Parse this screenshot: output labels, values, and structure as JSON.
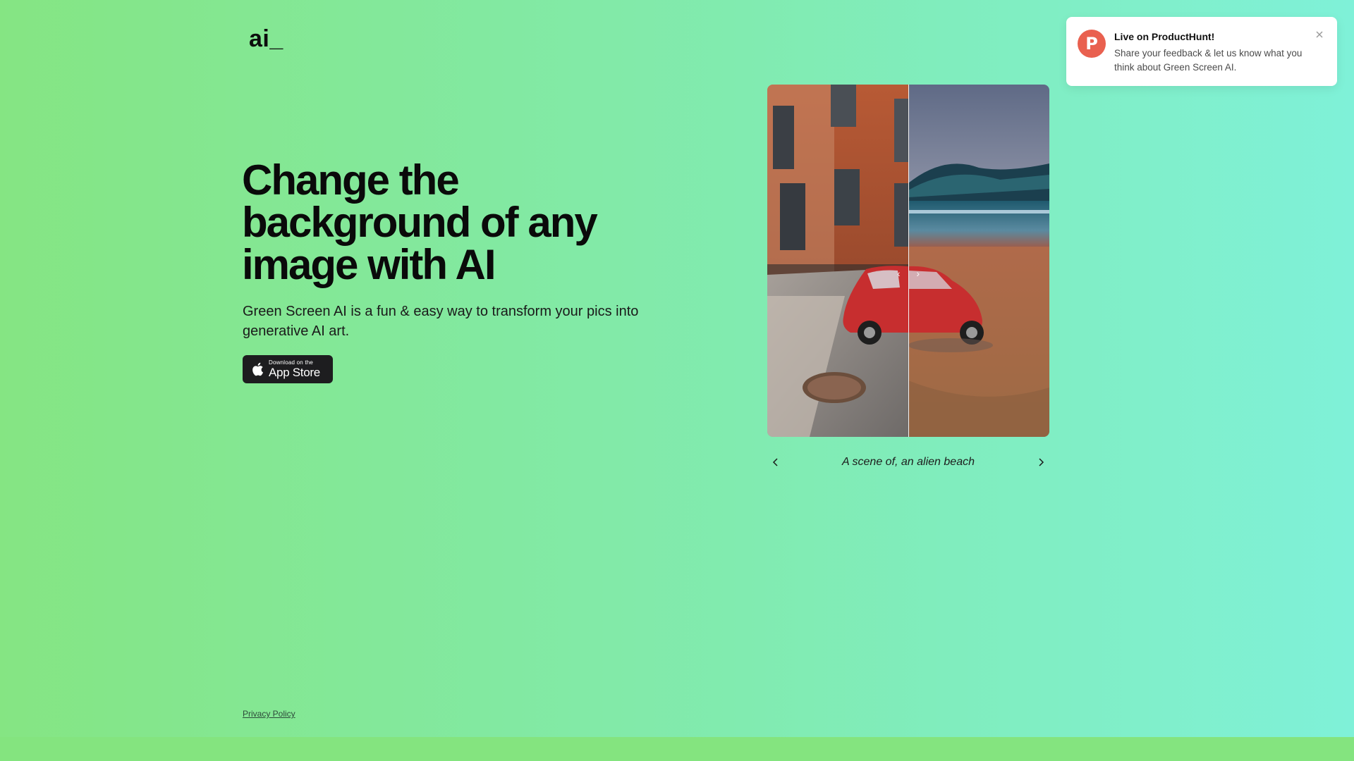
{
  "logo": "ai_",
  "hero": {
    "headline_lines": [
      "Change the",
      "background of any",
      "image with AI"
    ],
    "subtitle": "Green Screen AI is a fun & easy way to transform your pics into generative AI art.",
    "app_store": {
      "small_label": "Download on the",
      "big_label": "App Store"
    }
  },
  "carousel": {
    "caption": "A scene of, an alien beach",
    "prev_icon": "chevron-left-icon",
    "next_icon": "chevron-right-icon"
  },
  "footer": {
    "privacy_label": "Privacy Policy"
  },
  "toast": {
    "badge_letter": "P",
    "title": "Live on ProductHunt!",
    "message": "Share your feedback & let us know what you think about Green Screen AI.",
    "close_icon": "close-icon"
  },
  "colors": {
    "gradient_left": "#85e583",
    "gradient_right": "#7ff1d8",
    "producthunt": "#e9604f",
    "app_store_bg": "#1d1d1f"
  }
}
